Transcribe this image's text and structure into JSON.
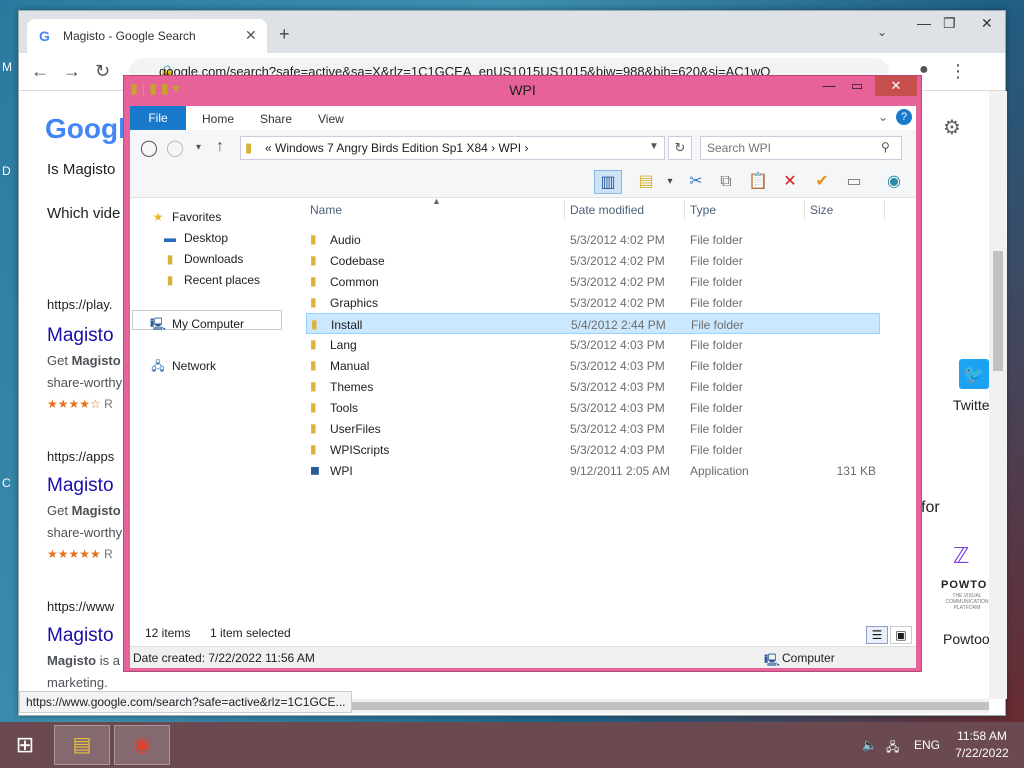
{
  "desktop": {
    "letters": [
      "M",
      "D",
      "C"
    ]
  },
  "browser": {
    "tab_title": "Magisto - Google Search",
    "url": "google.com/search?safe=active&sa=X&rlz=1C1GCEA_enUS1015US1015&biw=988&bih=620&si=AC1wQ",
    "status_url": "https://www.google.com/search?safe=active&rlz=1C1GCE...",
    "logo": "Google",
    "page": {
      "q1": "Is Magisto",
      "q2": "Which vide",
      "results": [
        {
          "url": "https://play.",
          "title": "Magisto",
          "snippet1_bold": "Magisto",
          "snippet1_pre": "Get ",
          "snippet2": "share-worthy",
          "stars": "★★★★☆",
          "rating": "R"
        },
        {
          "url": "https://apps",
          "title": "Magisto",
          "snippet1_bold": "Magisto",
          "snippet1_pre": "Get ",
          "snippet2": "share-worthy",
          "stars": "★★★★★",
          "rating": "R"
        },
        {
          "url": "https://www",
          "title": "Magisto",
          "snippet1_bold": "Magisto",
          "snippet1_pre": " is a",
          "snippet2": "marketing."
        }
      ],
      "right_twitter": "Twitte",
      "right_for": "for",
      "right_powtoon_logo": "POWTO",
      "right_powtoon_tag": "THE VISUAL COMMUNICATION PLATFORM",
      "right_powtoon": "Powtoo"
    }
  },
  "explorer": {
    "title": "WPI",
    "ribbon_tabs": [
      "File",
      "Home",
      "Share",
      "View"
    ],
    "breadcrumb": "«  Windows 7 Angry Birds Edition Sp1 X84  ›  WPI  ›",
    "search_placeholder": "Search WPI",
    "nav": {
      "favorites": "Favorites",
      "desktop": "Desktop",
      "downloads": "Downloads",
      "recent": "Recent places",
      "computer": "My Computer",
      "network": "Network"
    },
    "columns": {
      "name": "Name",
      "date": "Date modified",
      "type": "Type",
      "size": "Size"
    },
    "files": [
      {
        "name": "Audio",
        "date": "5/3/2012 4:02 PM",
        "type": "File folder",
        "size": ""
      },
      {
        "name": "Codebase",
        "date": "5/3/2012 4:02 PM",
        "type": "File folder",
        "size": ""
      },
      {
        "name": "Common",
        "date": "5/3/2012 4:02 PM",
        "type": "File folder",
        "size": ""
      },
      {
        "name": "Graphics",
        "date": "5/3/2012 4:02 PM",
        "type": "File folder",
        "size": ""
      },
      {
        "name": "Install",
        "date": "5/4/2012 2:44 PM",
        "type": "File folder",
        "size": ""
      },
      {
        "name": "Lang",
        "date": "5/3/2012 4:03 PM",
        "type": "File folder",
        "size": ""
      },
      {
        "name": "Manual",
        "date": "5/3/2012 4:03 PM",
        "type": "File folder",
        "size": ""
      },
      {
        "name": "Themes",
        "date": "5/3/2012 4:03 PM",
        "type": "File folder",
        "size": ""
      },
      {
        "name": "Tools",
        "date": "5/3/2012 4:03 PM",
        "type": "File folder",
        "size": ""
      },
      {
        "name": "UserFiles",
        "date": "5/3/2012 4:03 PM",
        "type": "File folder",
        "size": ""
      },
      {
        "name": "WPIScripts",
        "date": "5/3/2012 4:03 PM",
        "type": "File folder",
        "size": ""
      },
      {
        "name": "WPI",
        "date": "9/12/2011 2:05 AM",
        "type": "Application",
        "size": "131 KB"
      }
    ],
    "selected_index": 4,
    "status_items": "12 items",
    "status_selected": "1 item selected",
    "date_created": "Date created: 7/22/2022 11:56 AM",
    "location": "Computer"
  },
  "taskbar": {
    "lang": "ENG",
    "time": "11:58 AM",
    "date": "7/22/2022"
  },
  "colors": {
    "explorer_frame": "#e8629a",
    "ribbon_file": "#1979ca",
    "selection": "#cce8ff",
    "link": "#1a0dab"
  }
}
